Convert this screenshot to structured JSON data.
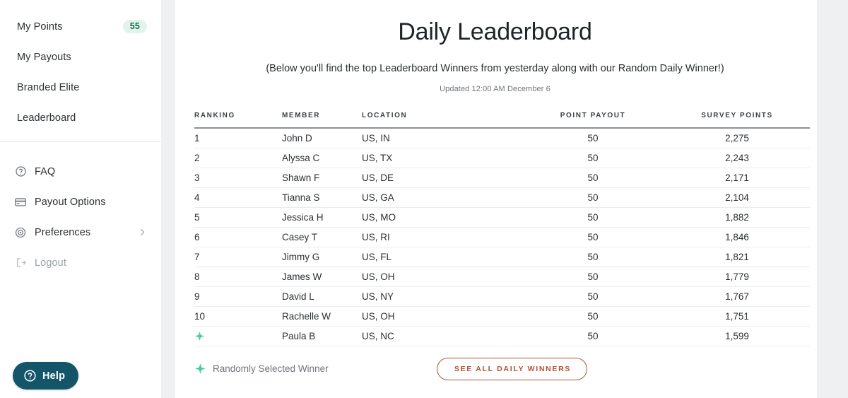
{
  "sidebar": {
    "primary_items": [
      {
        "label": "My Points",
        "badge": "55"
      },
      {
        "label": "My Payouts",
        "badge": null
      },
      {
        "label": "Branded Elite",
        "badge": null
      },
      {
        "label": "Leaderboard",
        "badge": null
      }
    ],
    "secondary_items": [
      {
        "label": "FAQ",
        "icon": "question-circle-icon",
        "chevron": false,
        "muted": false
      },
      {
        "label": "Payout Options",
        "icon": "credit-card-icon",
        "chevron": false,
        "muted": false
      },
      {
        "label": "Preferences",
        "icon": "gear-icon",
        "chevron": true,
        "muted": false
      },
      {
        "label": "Logout",
        "icon": "logout-icon",
        "chevron": false,
        "muted": true
      }
    ],
    "help_button": {
      "label": "Help",
      "icon": "question-circle-icon"
    }
  },
  "main": {
    "title": "Daily Leaderboard",
    "subtitle": "(Below you'll find the top Leaderboard Winners from yesterday along with our Random Daily Winner!)",
    "updated": "Updated 12:00 AM December 6",
    "table": {
      "columns": [
        "RANKING",
        "MEMBER",
        "LOCATION",
        "POINT PAYOUT",
        "SURVEY POINTS"
      ],
      "rows": [
        {
          "rank": "1",
          "is_random_winner": false,
          "member": "John D",
          "location": "US, IN",
          "payout": "50",
          "points": "2,275"
        },
        {
          "rank": "2",
          "is_random_winner": false,
          "member": "Alyssa C",
          "location": "US, TX",
          "payout": "50",
          "points": "2,243"
        },
        {
          "rank": "3",
          "is_random_winner": false,
          "member": "Shawn F",
          "location": "US, DE",
          "payout": "50",
          "points": "2,171"
        },
        {
          "rank": "4",
          "is_random_winner": false,
          "member": "Tianna S",
          "location": "US, GA",
          "payout": "50",
          "points": "2,104"
        },
        {
          "rank": "5",
          "is_random_winner": false,
          "member": "Jessica H",
          "location": "US, MO",
          "payout": "50",
          "points": "1,882"
        },
        {
          "rank": "6",
          "is_random_winner": false,
          "member": "Casey T",
          "location": "US, RI",
          "payout": "50",
          "points": "1,846"
        },
        {
          "rank": "7",
          "is_random_winner": false,
          "member": "Jimmy G",
          "location": "US, FL",
          "payout": "50",
          "points": "1,821"
        },
        {
          "rank": "8",
          "is_random_winner": false,
          "member": "James W",
          "location": "US, OH",
          "payout": "50",
          "points": "1,779"
        },
        {
          "rank": "9",
          "is_random_winner": false,
          "member": "David L",
          "location": "US, NY",
          "payout": "50",
          "points": "1,767"
        },
        {
          "rank": "10",
          "is_random_winner": false,
          "member": "Rachelle W",
          "location": "US, OH",
          "payout": "50",
          "points": "1,751"
        },
        {
          "rank": "",
          "is_random_winner": true,
          "member": "Paula B",
          "location": "US, NC",
          "payout": "50",
          "points": "1,599"
        }
      ]
    },
    "footer": {
      "legend_label": "Randomly Selected Winner",
      "legend_icon": "sparkle-icon",
      "cta_label": "SEE ALL DAILY WINNERS"
    }
  },
  "colors": {
    "accent_teal": "#14556a",
    "badge_bg": "#e2f3ec",
    "badge_text": "#1c6b50",
    "sparkle_green": "#4ecca0",
    "cta_rust": "#b45130",
    "page_bg": "#eff0f2"
  }
}
